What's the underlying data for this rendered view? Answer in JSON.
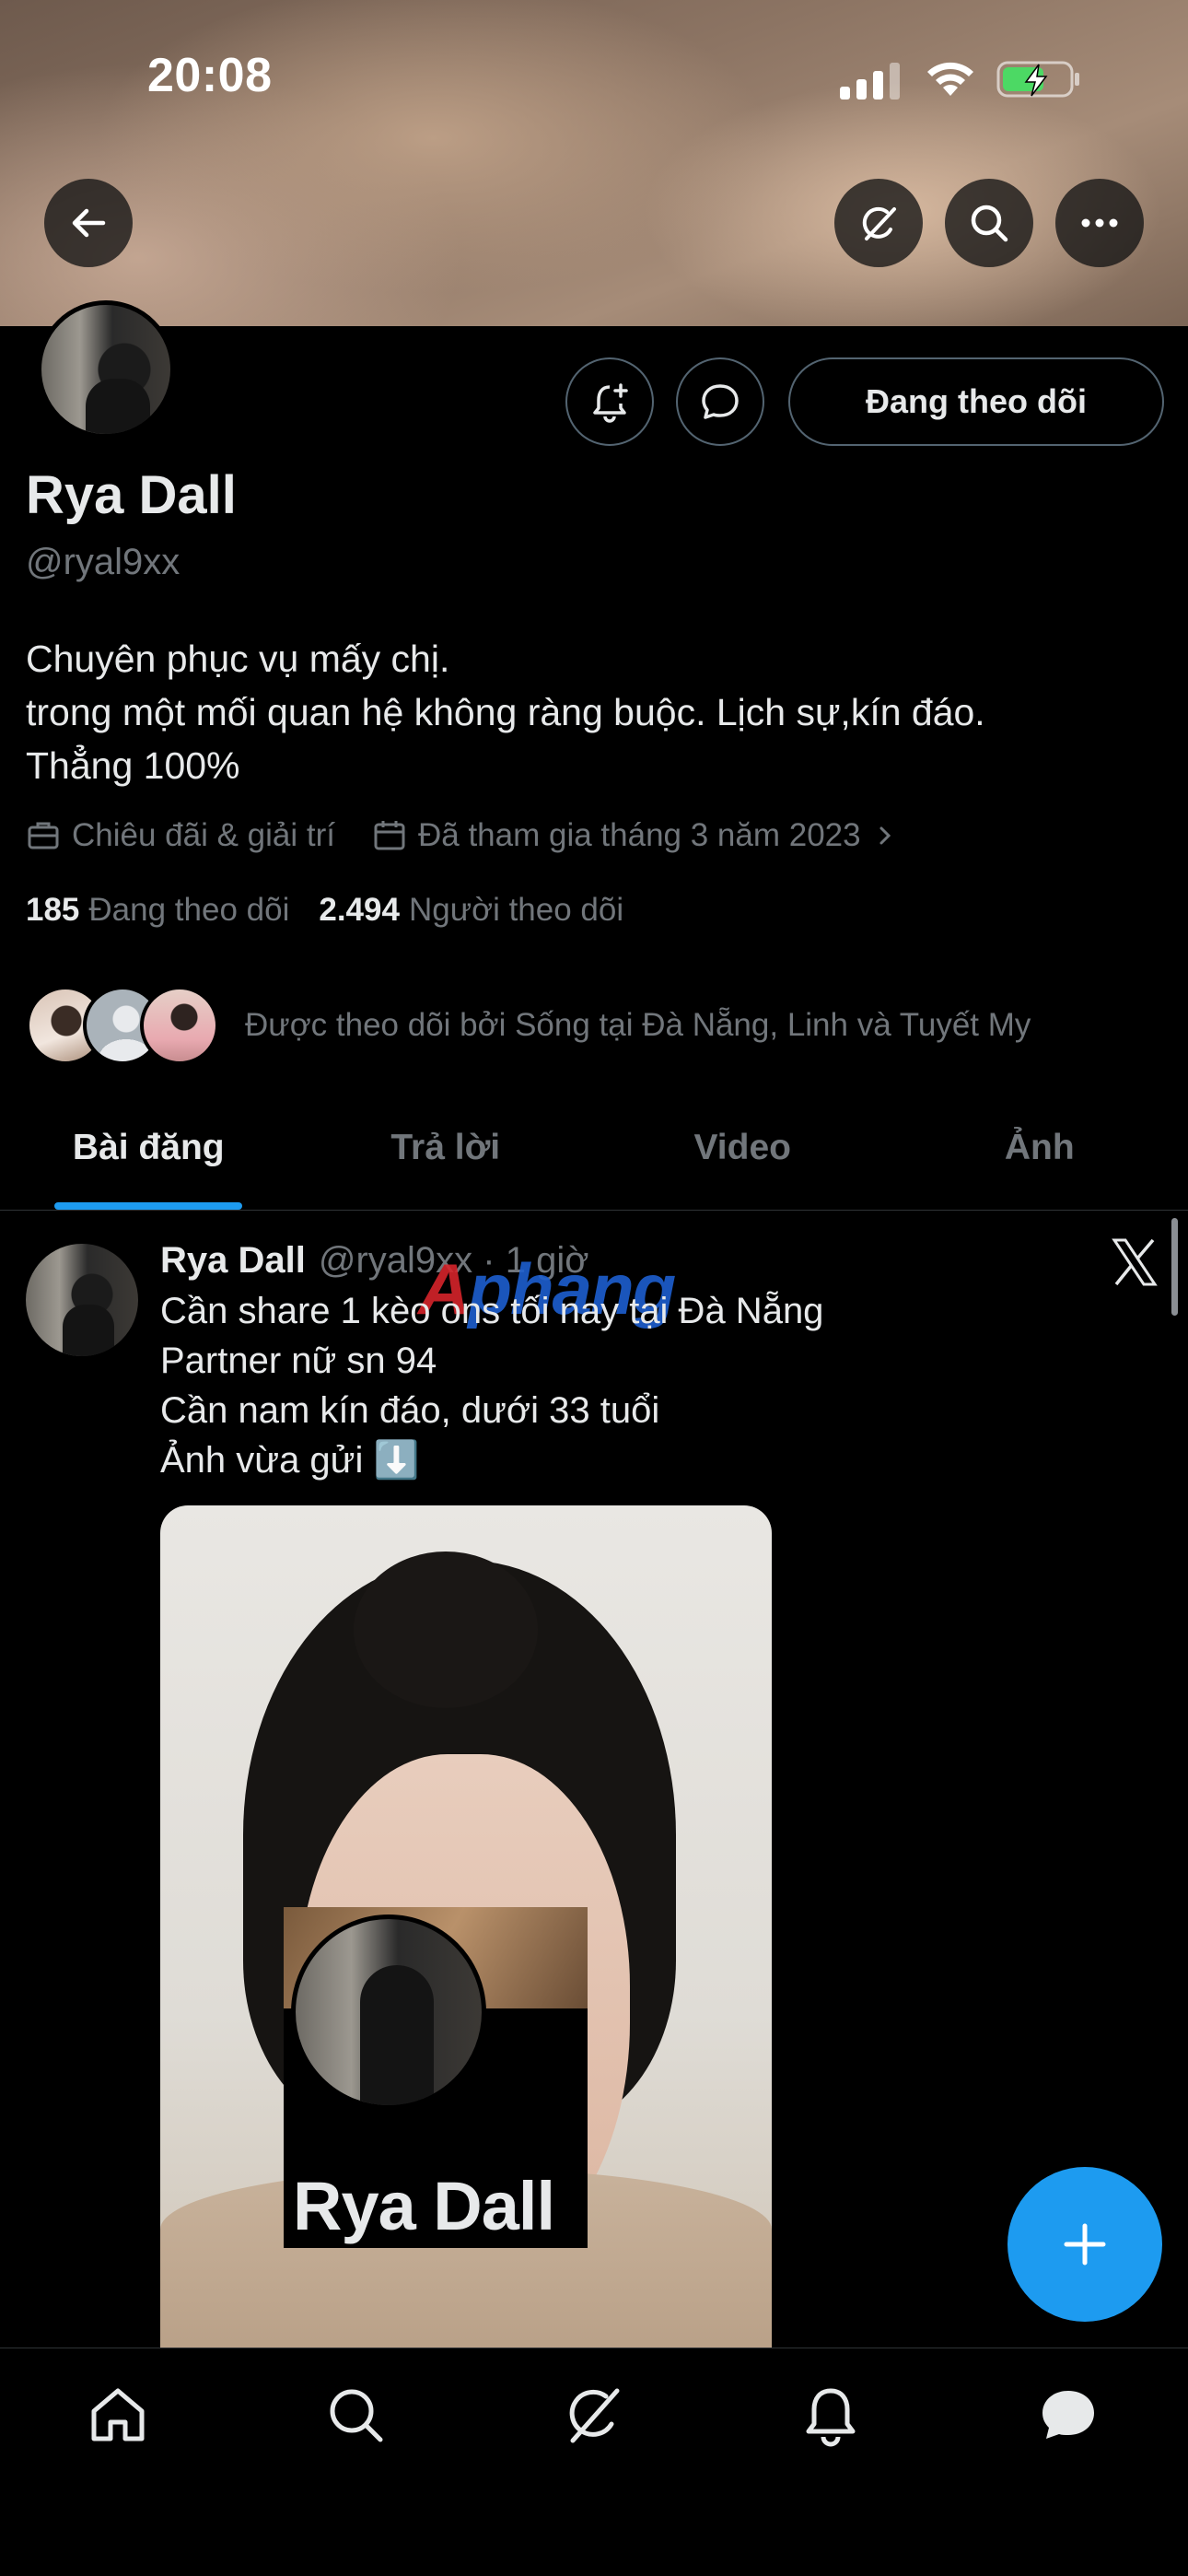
{
  "status_bar": {
    "time": "20:08"
  },
  "profile": {
    "name": "Rya Dall",
    "handle": "@ryal9xx",
    "follow_button": "Đang theo dõi",
    "bio_lines": [
      "Chuyên phục vụ mấy chị.",
      "trong một mối quan hệ không ràng buộc. Lịch sự,kín đáo.",
      "Thẳng 100%"
    ],
    "category": "Chiêu đãi & giải trí",
    "joined": "Đã tham gia tháng 3 năm 2023",
    "following_count": "185",
    "following_label": "Đang theo dõi",
    "followers_count": "2.494",
    "followers_label": "Người theo dõi",
    "followed_by": "Được theo dõi bởi Sống tại Đà Nẵng, Linh và Tuyết My"
  },
  "tabs": [
    {
      "label": "Bài đăng",
      "active": true
    },
    {
      "label": "Trả lời",
      "active": false
    },
    {
      "label": "Video",
      "active": false
    },
    {
      "label": "Ảnh",
      "active": false
    }
  ],
  "post": {
    "name": "Rya Dall",
    "meta": "@ryal9xx · 1 giờ",
    "lines": [
      "Cần share 1 kèo ons tối nay tại Đà Nẵng",
      "Partner nữ sn 94",
      "Cần nam kín đáo, dưới 33 tuổi",
      "Ảnh vừa gửi ⬇️"
    ],
    "overlay_name": "Rya Dall"
  },
  "watermark": {
    "part1": "A",
    "part2": "phang"
  },
  "colors": {
    "accent": "#1d9bf0",
    "muted": "#71767b",
    "text": "#e7e9ea",
    "border": "#2f3336"
  },
  "icons": {
    "back": "arrow-left-icon",
    "grok": "grok-icon",
    "search": "search-icon",
    "more": "more-icon",
    "bell": "bell-plus-icon",
    "message": "message-icon",
    "x": "x-logo-icon",
    "compose": "plus-icon"
  }
}
